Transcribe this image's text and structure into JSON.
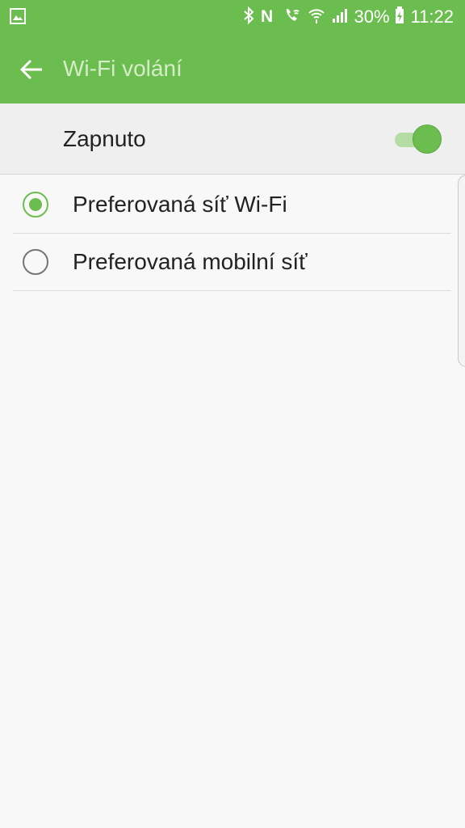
{
  "status_bar": {
    "battery_percent": "30%",
    "time": "11:22",
    "icons": [
      "gallery-icon",
      "bluetooth-icon",
      "nfc-icon",
      "wifi-calling-icon",
      "wifi-icon",
      "signal-icon",
      "battery-charging-icon"
    ]
  },
  "app_bar": {
    "title": "Wi-Fi volání"
  },
  "master_switch": {
    "label": "Zapnuto",
    "state": "on"
  },
  "options": [
    {
      "label": "Preferovaná síť Wi-Fi",
      "selected": true
    },
    {
      "label": "Preferovaná mobilní síť",
      "selected": false
    }
  ],
  "colors": {
    "accent": "#6cbd4f",
    "title_text": "#d6ecc8",
    "background": "#f8f8f8"
  }
}
